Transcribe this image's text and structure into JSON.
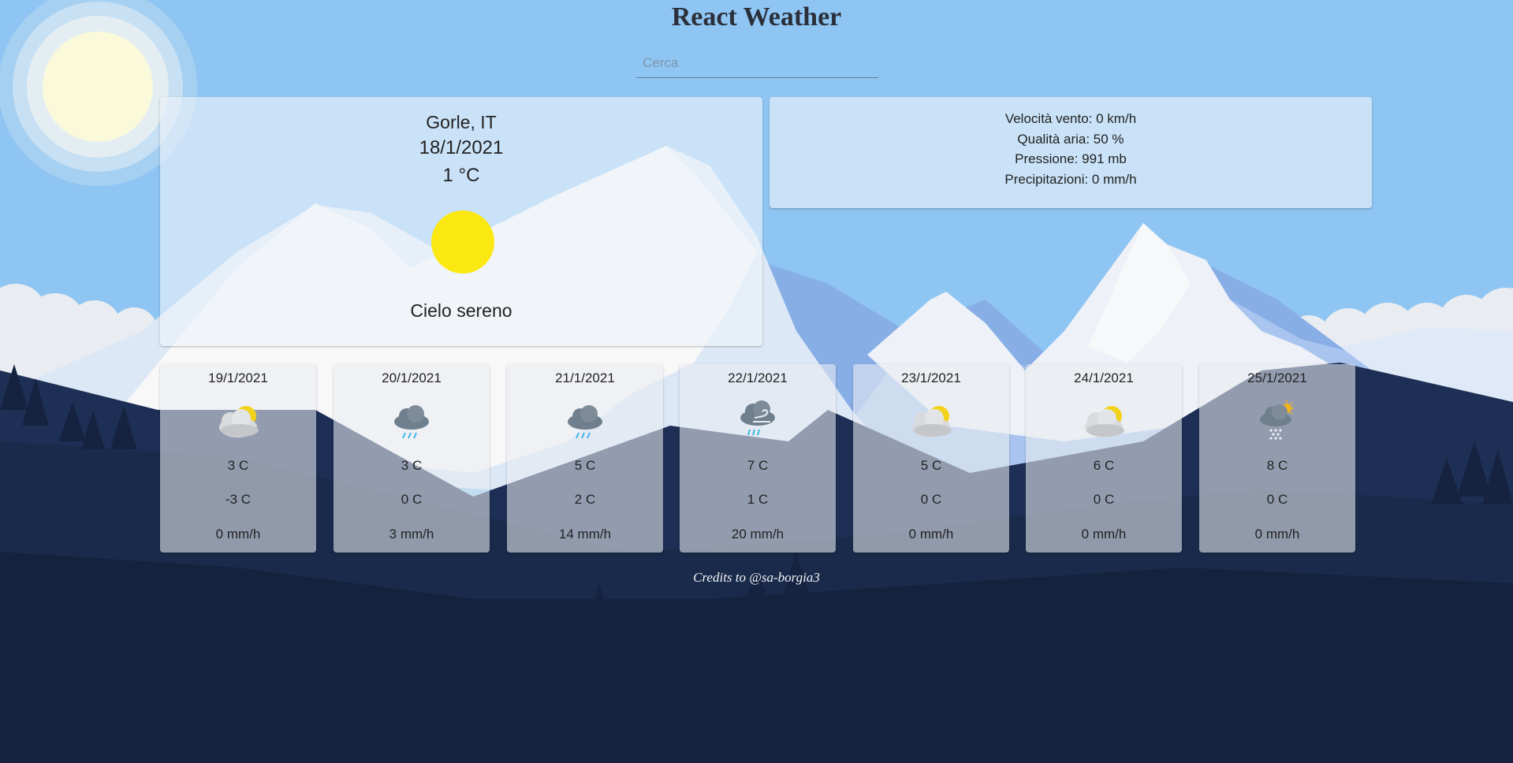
{
  "header": {
    "title": "React Weather"
  },
  "search": {
    "placeholder": "Cerca",
    "value": ""
  },
  "current": {
    "location": "Gorle, IT",
    "date": "18/1/2021",
    "temperature": "1 °C",
    "icon": "clear-sun-icon",
    "description": "Cielo sereno"
  },
  "details": {
    "wind": "Velocità vento: 0 km/h",
    "air_quality": "Qualità aria: 50 %",
    "pressure": "Pressione: 991 mb",
    "precipitation": "Precipitazioni: 0 mm/h"
  },
  "forecast": [
    {
      "date": "19/1/2021",
      "icon": "partly-cloudy-icon",
      "max": "3 C",
      "min": "-3 C",
      "precip": "0 mm/h"
    },
    {
      "date": "20/1/2021",
      "icon": "rain-cloud-icon",
      "max": "3 C",
      "min": "0 C",
      "precip": "3 mm/h"
    },
    {
      "date": "21/1/2021",
      "icon": "rain-cloud-icon",
      "max": "5 C",
      "min": "2 C",
      "precip": "14 mm/h"
    },
    {
      "date": "22/1/2021",
      "icon": "wind-rain-cloud-icon",
      "max": "7 C",
      "min": "1 C",
      "precip": "20 mm/h"
    },
    {
      "date": "23/1/2021",
      "icon": "partly-cloudy-icon",
      "max": "5 C",
      "min": "0 C",
      "precip": "0 mm/h"
    },
    {
      "date": "24/1/2021",
      "icon": "partly-cloudy-icon",
      "max": "6 C",
      "min": "0 C",
      "precip": "0 mm/h"
    },
    {
      "date": "25/1/2021",
      "icon": "snow-sun-cloud-icon",
      "max": "8 C",
      "min": "0 C",
      "precip": "0 mm/h"
    }
  ],
  "footer": {
    "credits": "Credits to @sa-borgia3"
  },
  "colors": {
    "sky": "#8fc5f2",
    "sun": "#fbe813",
    "night_forest": "#13213a"
  }
}
